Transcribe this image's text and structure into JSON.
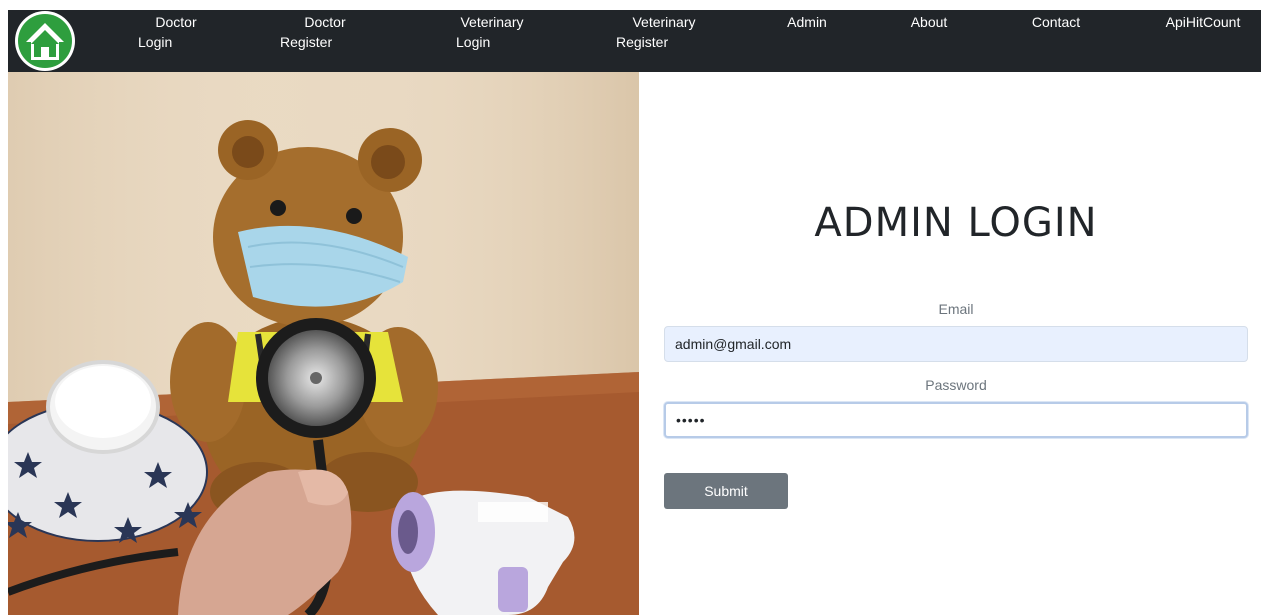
{
  "navbar": {
    "items": [
      {
        "line1": "Doctor",
        "line2": "Login"
      },
      {
        "line1": "Doctor",
        "line2": "Register"
      },
      {
        "line1": "Veterinary",
        "line2": "Login"
      },
      {
        "line1": "Veterinary",
        "line2": "Register"
      },
      {
        "line1": "Admin",
        "line2": ""
      },
      {
        "line1": "About",
        "line2": ""
      },
      {
        "line1": "Contact",
        "line2": ""
      },
      {
        "line1": "ApiHitCount",
        "line2": ""
      }
    ],
    "logo_icon": "home-icon",
    "logo_color": "#2e9e3e",
    "background": "#212529"
  },
  "login": {
    "title": "ADMIN LOGIN",
    "email_label": "Email",
    "email_value": "admin@gmail.com",
    "password_label": "Password",
    "password_value": "•••••",
    "submit_label": "Submit"
  }
}
